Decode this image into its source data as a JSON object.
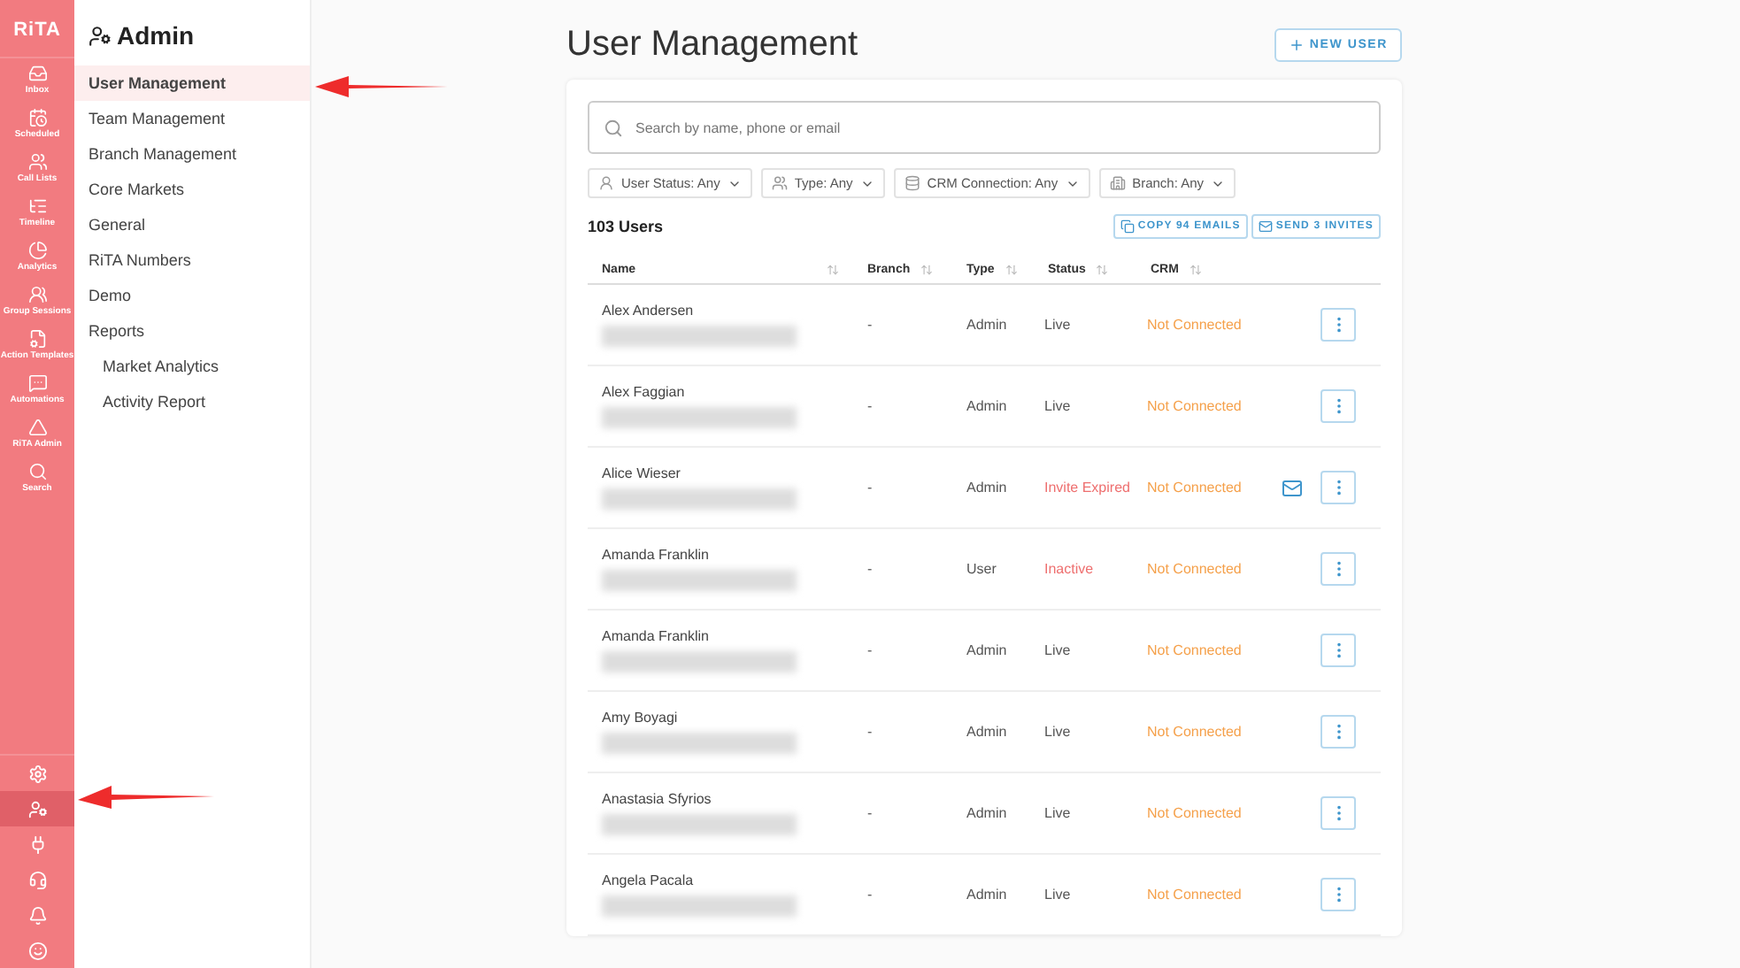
{
  "rail": {
    "logo": "RiTA",
    "items": [
      {
        "label": "Inbox"
      },
      {
        "label": "Scheduled"
      },
      {
        "label": "Call Lists"
      },
      {
        "label": "Timeline"
      },
      {
        "label": "Analytics"
      },
      {
        "label": "Group Sessions"
      },
      {
        "label": "Action Templates"
      },
      {
        "label": "Automations"
      },
      {
        "label": "RiTA Admin"
      },
      {
        "label": "Search"
      }
    ],
    "bottom": [
      {
        "selected": false
      },
      {
        "selected": true
      },
      {
        "selected": false
      },
      {
        "selected": false
      },
      {
        "selected": false
      },
      {
        "selected": false
      }
    ]
  },
  "sidebar": {
    "title": "Admin",
    "items": [
      {
        "label": "User Management",
        "selected": true
      },
      {
        "label": "Team Management",
        "selected": false
      },
      {
        "label": "Branch Management",
        "selected": false
      },
      {
        "label": "Core Markets",
        "selected": false
      },
      {
        "label": "General",
        "selected": false
      },
      {
        "label": "RiTA Numbers",
        "selected": false
      },
      {
        "label": "Demo",
        "selected": false
      },
      {
        "label": "Reports",
        "selected": false,
        "children": [
          {
            "label": "Market Analytics",
            "selected": false
          },
          {
            "label": "Activity Report",
            "selected": false
          }
        ]
      }
    ]
  },
  "page": {
    "title": "User Management",
    "new_button": "NEW USER"
  },
  "search": {
    "placeholder": "Search by name, phone or email"
  },
  "filters": [
    "User Status: Any",
    "Type: Any",
    "CRM Connection: Any",
    "Branch: Any"
  ],
  "count": "103 Users",
  "actions": [
    "COPY 94 EMAILS",
    "SEND 3 INVITES"
  ],
  "table": {
    "columns": [
      "Name",
      "Branch",
      "Type",
      "Status",
      "CRM"
    ],
    "rows": [
      {
        "name": "Alex Andersen",
        "branch": "-",
        "type": "Admin",
        "status": {
          "text": "Live",
          "color": "#555555"
        },
        "crm": "Not Connected",
        "invite": false
      },
      {
        "name": "Alex Faggian",
        "branch": "-",
        "type": "Admin",
        "status": {
          "text": "Live",
          "color": "#555555"
        },
        "crm": "Not Connected",
        "invite": false
      },
      {
        "name": "Alice Wieser",
        "branch": "-",
        "type": "Admin",
        "status": {
          "text": "Invite Expired",
          "color": "#ee6f6f"
        },
        "crm": "Not Connected",
        "invite": true
      },
      {
        "name": "Amanda Franklin",
        "branch": "-",
        "type": "User",
        "status": {
          "text": "Inactive",
          "color": "#ee6f6f"
        },
        "crm": "Not Connected",
        "invite": false
      },
      {
        "name": "Amanda Franklin",
        "branch": "-",
        "type": "Admin",
        "status": {
          "text": "Live",
          "color": "#555555"
        },
        "crm": "Not Connected",
        "invite": false
      },
      {
        "name": "Amy Boyagi",
        "branch": "-",
        "type": "Admin",
        "status": {
          "text": "Live",
          "color": "#555555"
        },
        "crm": "Not Connected",
        "invite": false
      },
      {
        "name": "Anastasia Sfyrios",
        "branch": "-",
        "type": "Admin",
        "status": {
          "text": "Live",
          "color": "#555555"
        },
        "crm": "Not Connected",
        "invite": false
      },
      {
        "name": "Angela Pacala",
        "branch": "-",
        "type": "Admin",
        "status": {
          "text": "Live",
          "color": "#555555"
        },
        "crm": "Not Connected",
        "invite": false
      }
    ]
  }
}
